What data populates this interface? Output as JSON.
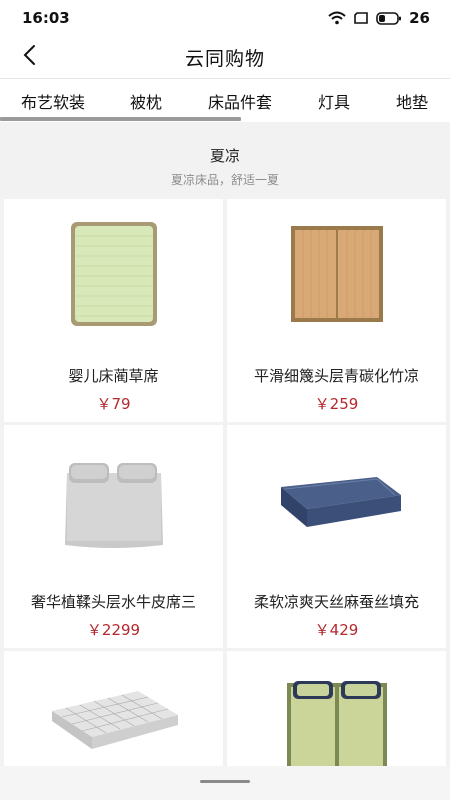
{
  "status_bar": {
    "time": "16:03",
    "battery": "26"
  },
  "nav": {
    "title": "云同购物"
  },
  "tabs": [
    "布艺软装",
    "被枕",
    "床品件套",
    "灯具",
    "地垫"
  ],
  "section": {
    "title": "夏凉",
    "subtitle": "夏凉床品，舒适一夏"
  },
  "products": [
    {
      "name": "婴儿床蔺草席",
      "price": "￥79",
      "image": "baby-straw-mat-image"
    },
    {
      "name": "平滑细篾头层青碳化竹凉",
      "price": "￥259",
      "image": "bamboo-mat-image"
    },
    {
      "name": "奢华植鞣头层水牛皮席三",
      "price": "￥2299",
      "image": "buffalo-leather-mat-image"
    },
    {
      "name": "柔软凉爽天丝麻蚕丝填充",
      "price": "￥429",
      "image": "silk-quilt-image"
    },
    {
      "name": "",
      "price": "",
      "image": "plaid-quilt-image"
    },
    {
      "name": "",
      "price": "",
      "image": "double-straw-mat-image"
    }
  ],
  "colors": {
    "price": "#b5282e",
    "background": "#f2f2f2",
    "card": "#ffffff",
    "tab_indicator": "#9a9a9a"
  }
}
